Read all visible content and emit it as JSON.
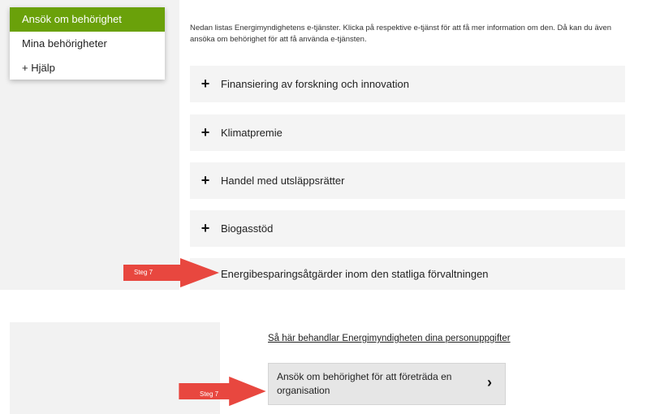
{
  "menu": {
    "items": [
      {
        "label": "Ansök om behörighet"
      },
      {
        "label": "Mina behörigheter"
      },
      {
        "label": "+ Hjälp"
      }
    ]
  },
  "intro_text_line1": "Nedan listas Energimyndighetens e-tjänster. Klicka på respektive e-tjänst för att få mer information om den. Då kan du även",
  "intro_text_line2": "ansöka om behörighet för att få använda e-tjänsten.",
  "accordion": [
    {
      "icon": "+",
      "label": "Finansiering av forskning och innovation"
    },
    {
      "icon": "+",
      "label": "Klimatpremie"
    },
    {
      "icon": "+",
      "label": "Handel med utsläppsrätter"
    },
    {
      "icon": "+",
      "label": "Biogasstöd"
    },
    {
      "icon": "−",
      "label": "Energibesparingsåtgärder inom den statliga förvaltningen"
    }
  ],
  "annotations": {
    "step_top": "Steg 7",
    "step_bottom": "Steg 7",
    "arrow_color": "#e8473f"
  },
  "privacy_link": "Så här behandlar Energimyndigheten dina personuppgifter",
  "apply_button": {
    "line1": "Ansök om behörighet för att företräda en",
    "line2": "organisation",
    "chevron": "›"
  },
  "colors": {
    "accent": "#6aa10a",
    "panel": "#f2f2f2",
    "accordion_bg": "#f4f4f4"
  }
}
